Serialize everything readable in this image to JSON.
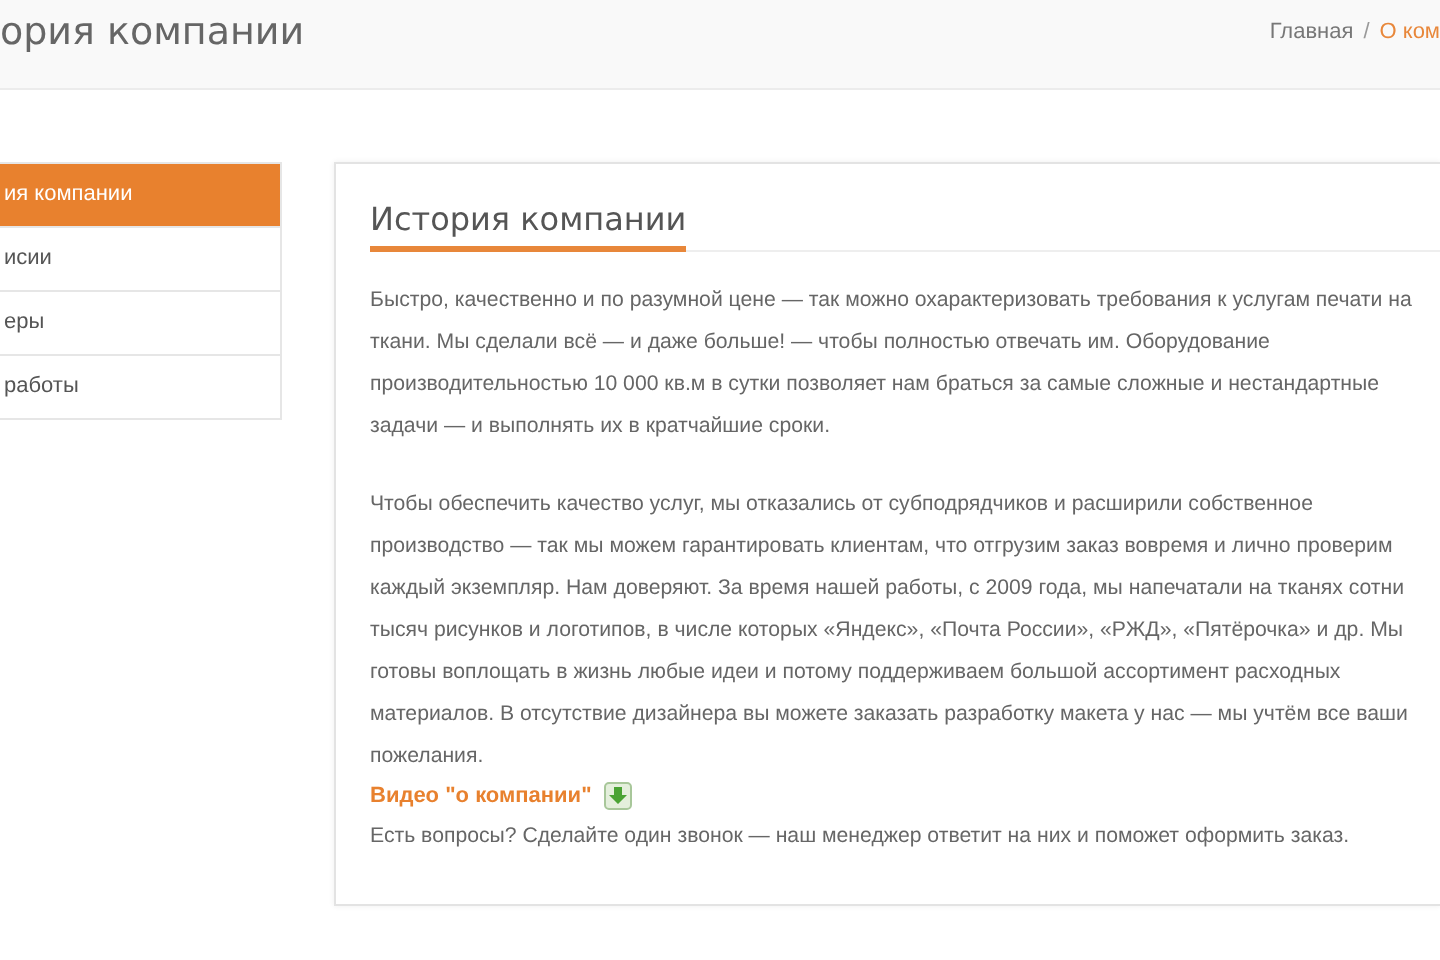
{
  "header": {
    "title": "ория компании",
    "breadcrumb_separator": "/",
    "breadcrumbs": [
      {
        "label": "Главная",
        "selected": false
      },
      {
        "label": "О ком",
        "selected": true
      }
    ]
  },
  "sidebar": {
    "items": [
      {
        "label": "ия компании",
        "selected": true
      },
      {
        "label": "исии",
        "selected": false
      },
      {
        "label": "еры",
        "selected": false
      },
      {
        "label": "работы",
        "selected": false
      }
    ]
  },
  "content": {
    "heading": "История компании",
    "paragraphs": [
      "Быстро, качественно и по разумной цене — так можно охарактеризовать требования к услугам печати на ткани. Мы сделали всё — и даже больше! — чтобы полностью отвечать им. Оборудование производительностью 10 000 кв.м в сутки позволяет нам браться за самые сложные и нестандартные задачи — и выполнять их в кратчайшие сроки.",
      "Чтобы обеспечить качество услуг, мы отказались от субподрядчиков и расширили собственное производство — так мы можем гарантировать клиентам, что отгрузим заказ вовремя и лично проверим каждый экземпляр. Нам доверяют. За время нашей работы, с 2009 года, мы напечатали на тканях сотни тысяч рисунков и логотипов, в числе которых «Яндекс», «Почта России», «РЖД», «Пятёрочка» и др. Мы готовы воплощать в жизнь любые идеи и потому поддерживаем большой ассортимент расходных материалов. В отсутствие дизайнера вы можете заказать разработку макета у нас — мы учтём все ваши пожелания."
    ],
    "video_link": "Видео \"о компании\"",
    "footer_text": "Есть вопросы? Сделайте один звонок — наш менеджер ответит на них и поможет оформить заказ."
  }
}
